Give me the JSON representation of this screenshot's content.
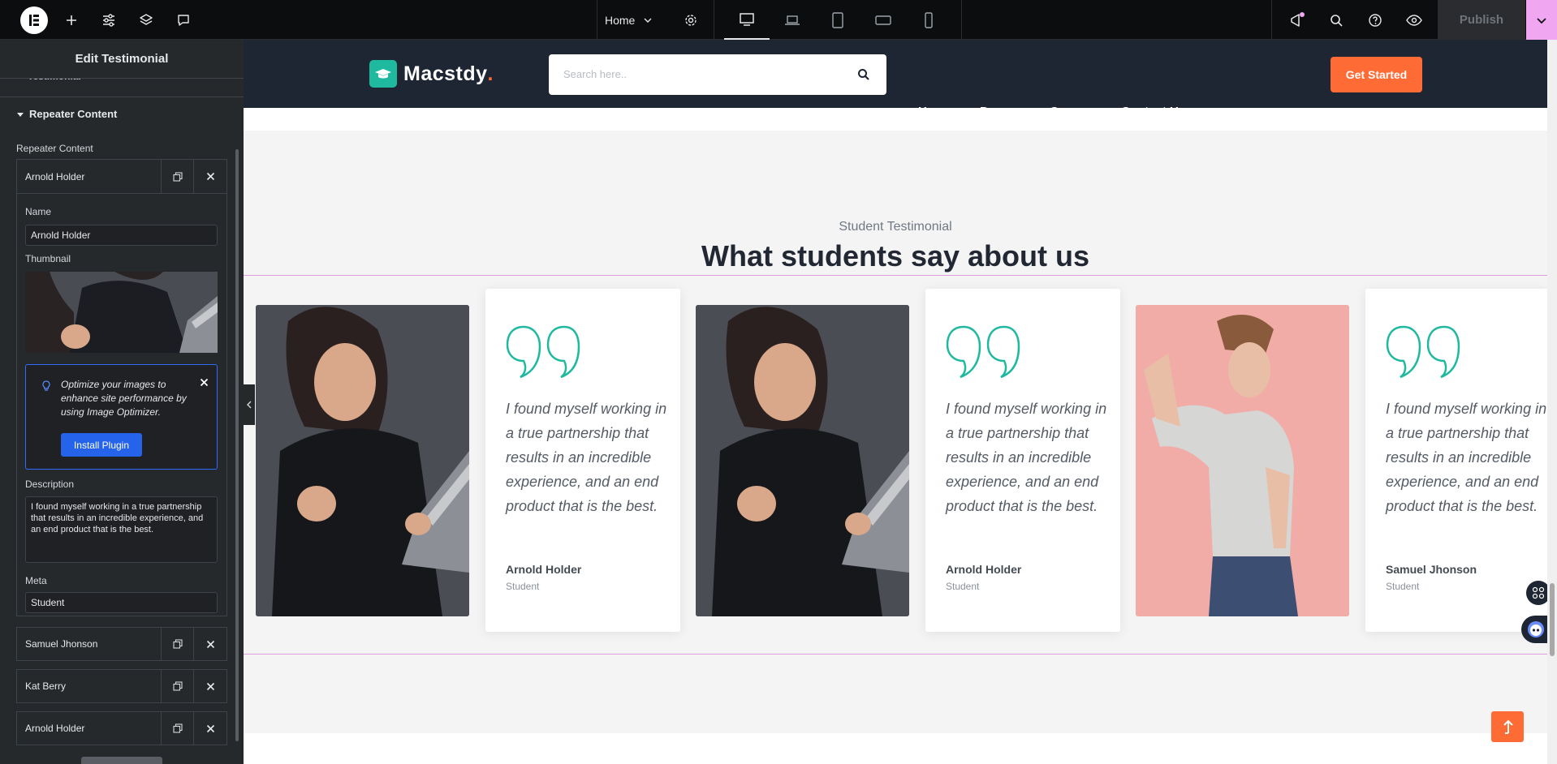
{
  "topbar": {
    "page_name": "Home",
    "publish_label": "Publish",
    "colors": {
      "accent": "#f0a6f0",
      "bg": "#0c0d0e"
    }
  },
  "panel": {
    "title": "Edit Testimonial",
    "prev_section_label": "Testimonial",
    "section_label": "Repeater Content",
    "repeater_label": "Repeater Content",
    "active_item": {
      "title": "Arnold Holder",
      "name_label": "Name",
      "name_value": "Arnold Holder",
      "thumbnail_label": "Thumbnail",
      "notice_text": "Optimize your images to enhance site performance by using Image Optimizer.",
      "install_label": "Install Plugin",
      "description_label": "Description",
      "description_value": "I found myself working in a true partnership that results in an incredible experience, and an end product that is the best.",
      "meta_label": "Meta",
      "meta_value": "Student"
    },
    "items": [
      {
        "title": "Samuel Jhonson"
      },
      {
        "title": "Kat Berry"
      },
      {
        "title": "Arnold Holder"
      }
    ]
  },
  "site": {
    "logo_text": "Macstdy",
    "logo_dot": ".",
    "search_placeholder": "Search here..",
    "nav": [
      {
        "label": "Home"
      },
      {
        "label": "Pages"
      },
      {
        "label": "Course"
      },
      {
        "label": "Contact Us"
      }
    ],
    "cta_label": "Get Started",
    "colors": {
      "header_bg": "#1e2533",
      "cta": "#ff6b35",
      "teal": "#1fb9a0"
    }
  },
  "section": {
    "subtitle": "Student Testimonial",
    "title": "What students say about us",
    "testimonials": [
      {
        "quote": "I found myself working in a true partnership that results in an incredible experience, and an end product that is the best.",
        "name": "Arnold Holder",
        "meta": "Student"
      },
      {
        "quote": "I found myself working in a true partnership that results in an incredible experience, and an end product that is the best.",
        "name": "Arnold Holder",
        "meta": "Student"
      },
      {
        "quote": "I found myself working in a true partnership that results in an incredible experience, and an end product that is the best.",
        "name": "Samuel Jhonson",
        "meta": "Student"
      }
    ]
  }
}
